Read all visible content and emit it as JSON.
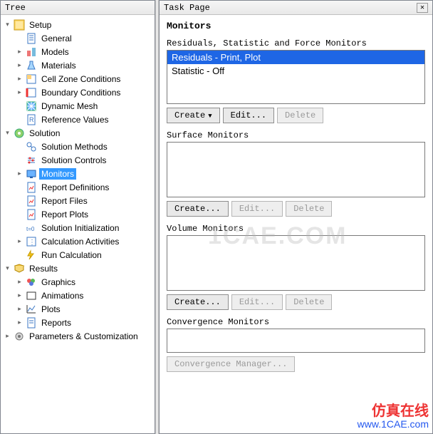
{
  "tree_panel_title": "Tree",
  "task_panel_title": "Task Page",
  "tree": {
    "setup": {
      "label": "Setup",
      "general": "General",
      "models": "Models",
      "materials": "Materials",
      "cell_zone": "Cell Zone Conditions",
      "boundary": "Boundary Conditions",
      "dynamic_mesh": "Dynamic Mesh",
      "reference": "Reference Values"
    },
    "solution": {
      "label": "Solution",
      "methods": "Solution Methods",
      "controls": "Solution Controls",
      "monitors": "Monitors",
      "report_defs": "Report Definitions",
      "report_files": "Report Files",
      "report_plots": "Report Plots",
      "init": "Solution Initialization",
      "calc_act": "Calculation Activities",
      "run": "Run Calculation"
    },
    "results": {
      "label": "Results",
      "graphics": "Graphics",
      "animations": "Animations",
      "plots": "Plots",
      "reports": "Reports"
    },
    "params": "Parameters & Customization"
  },
  "task": {
    "heading": "Monitors",
    "residuals_section": "Residuals, Statistic and Force Monitors",
    "residuals_items": {
      "a": "Residuals - Print, Plot",
      "b": "Statistic - Off"
    },
    "surface_section": "Surface Monitors",
    "volume_section": "Volume Monitors",
    "convergence_section": "Convergence Monitors",
    "btn_create_dd": "Create",
    "btn_create": "Create...",
    "btn_edit": "Edit...",
    "btn_delete": "Delete",
    "btn_conv_mgr": "Convergence Manager..."
  },
  "watermark_center": "1CAE.COM",
  "watermark_cn": "仿真在线",
  "watermark_url": "www.1CAE.com"
}
